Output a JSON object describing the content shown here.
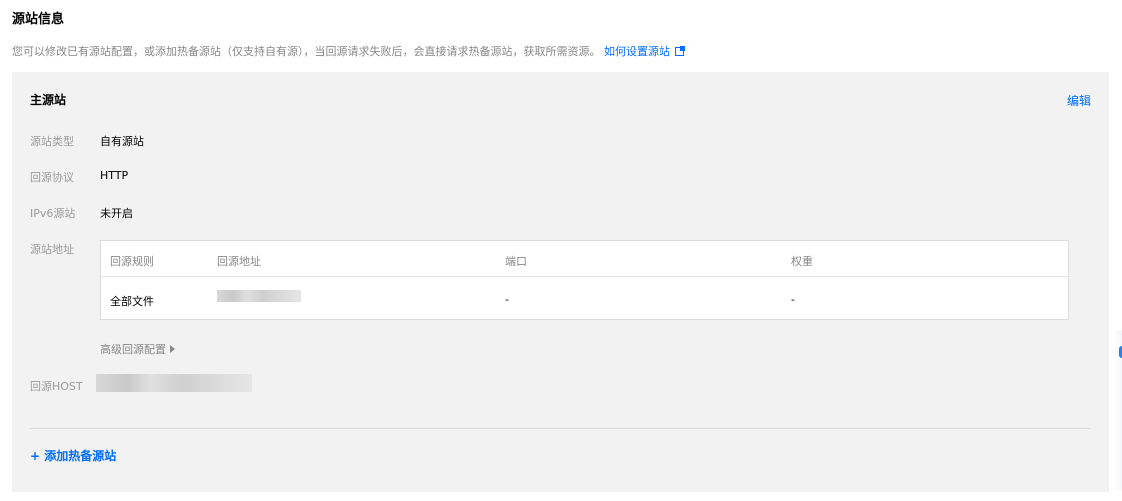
{
  "section": {
    "title": "源站信息",
    "description": "您可以修改已有源站配置，或添加热备源站（仅支持自有源），当回源请求失败后，会直接请求热备源站，获取所需资源。",
    "help_link": "如何设置源站"
  },
  "primary_origin": {
    "title": "主源站",
    "edit_label": "编辑",
    "fields": {
      "type_label": "源站类型",
      "type_value": "自有源站",
      "protocol_label": "回源协议",
      "protocol_value": "HTTP",
      "ipv6_label": "IPv6源站",
      "ipv6_value": "未开启",
      "address_label": "源站地址",
      "host_label": "回源HOST"
    },
    "table": {
      "headers": [
        "回源规则",
        "回源地址",
        "端口",
        "权重"
      ],
      "rows": [
        {
          "rule": "全部文件",
          "port": "-",
          "weight": "-"
        }
      ]
    },
    "advanced_label": "高级回源配置"
  },
  "add_backup_label": "+ 添加热备源站",
  "colors": {
    "link": "#006eff",
    "panel_bg": "#f2f2f2",
    "label_gray": "#9a9a9a"
  }
}
